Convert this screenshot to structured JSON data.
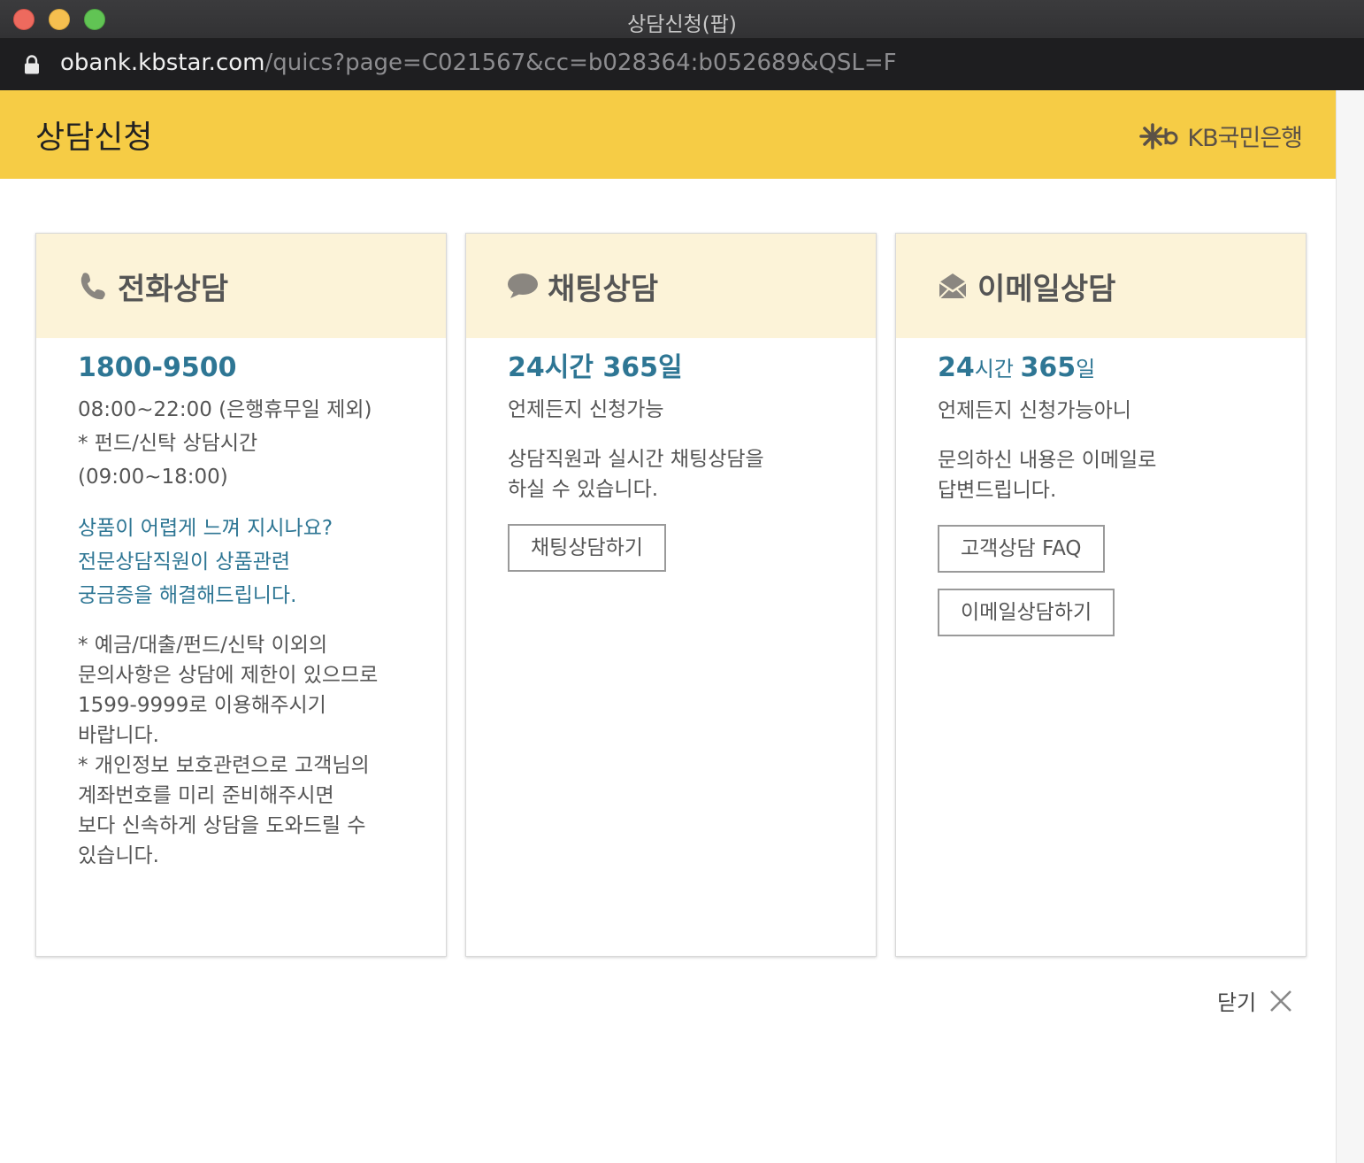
{
  "window": {
    "title": "상담신청(팝)",
    "url_host": "obank.kbstar.com",
    "url_path": "/quics?page=C021567&cc=b028364:b052689&QSL=F"
  },
  "header": {
    "title": "상담신청",
    "brand": "KB국민은행",
    "color": "#f6cc45"
  },
  "cards": {
    "phone": {
      "icon": "phone-icon",
      "title": "전화상담",
      "number": "1800-9500",
      "hours": "08:00~22:00 (은행휴무일 제외)",
      "fund_note_1": "* 펀드/신탁 상담시간",
      "fund_note_2": "(09:00~18:00)",
      "promo_1": "상품이 어렵게 느껴 지시나요?",
      "promo_2": "전문상담직원이 상품관련",
      "promo_3": "궁금증을 해결해드립니다.",
      "note_1": "* 예금/대출/펀드/신탁 이외의",
      "note_2": "문의사항은 상담에 제한이 있으므로",
      "note_3": "1599-9999로 이용해주시기",
      "note_4": "바랍니다.",
      "note_5": "* 개인정보 보호관련으로 고객님의",
      "note_6": "계좌번호를 미리 준비해주시면",
      "note_7": "보다 신속하게 상담을 도와드릴 수",
      "note_8": "있습니다."
    },
    "chat": {
      "icon": "chat-bubble-icon",
      "title": "채팅상담",
      "hours_num1": "24",
      "hours_unit1": "시간 ",
      "hours_num2": "365",
      "hours_unit2": "일",
      "sub": "언제든지 신청가능",
      "desc_1": "상담직원과 실시간 채팅상담을",
      "desc_2": "하실 수 있습니다.",
      "button": "채팅상담하기"
    },
    "email": {
      "icon": "envelope-icon",
      "title": "이메일상담",
      "hours_num1": "24",
      "hours_unit1": "시간 ",
      "hours_num2": "365",
      "hours_unit2": "일",
      "sub": "언제든지 신청가능아니",
      "desc_1": "문의하신 내용은 이메일로",
      "desc_2": "답변드립니다.",
      "button_faq": "고객상담 FAQ",
      "button_email": "이메일상담하기"
    }
  },
  "close": {
    "label": "닫기",
    "icon": "close-icon"
  },
  "colors": {
    "accent_blue": "#2e7694",
    "card_head": "#fcf3d8"
  }
}
